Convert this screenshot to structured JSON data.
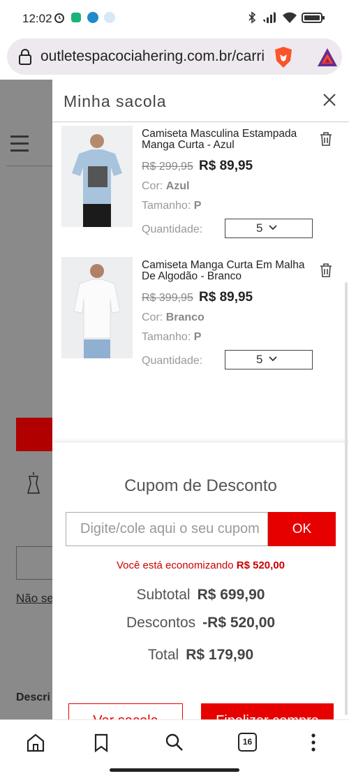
{
  "status": {
    "time": "12:02"
  },
  "browser": {
    "url": "outletespacociahering.com.br/carrinho"
  },
  "background": {
    "link_text": "Não se",
    "desc_text": "Descri"
  },
  "cart": {
    "title": "Minha sacola",
    "quantity_label": "Quantidade:",
    "color_label": "Cor:",
    "size_label": "Tamanho:",
    "items": [
      {
        "name": "Camiseta Masculina Estampada Manga Curta - Azul",
        "old_price": "R$ 299,95",
        "price": "R$ 89,95",
        "color": "Azul",
        "size": "P",
        "quantity": "5"
      },
      {
        "name": "Camiseta Manga Curta Em Malha De Algodão - Branco",
        "old_price": "R$ 399,95",
        "price": "R$ 89,95",
        "color": "Branco",
        "size": "P",
        "quantity": "5"
      }
    ]
  },
  "coupon": {
    "title": "Cupom de Desconto",
    "placeholder": "Digite/cole aqui o seu cupom",
    "ok_label": "OK",
    "savings_prefix": "Você está economizando",
    "savings_value": "R$ 520,00"
  },
  "summary": {
    "subtotal_label": "Subtotal",
    "subtotal_value": "R$ 699,90",
    "discount_label": "Descontos",
    "discount_value": "-R$ 520,00",
    "total_label": "Total",
    "total_value": "R$ 179,90"
  },
  "actions": {
    "view_cart": "Ver sacola",
    "checkout": "Finalizar compra"
  },
  "bottom_nav": {
    "tab_count": "16"
  }
}
